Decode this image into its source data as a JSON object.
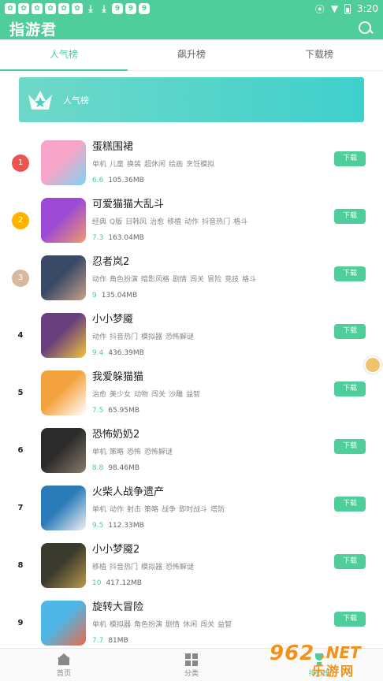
{
  "status_bar": {
    "left_icons": [
      "paw-notif-icon",
      "paw-notif-icon",
      "paw-notif-icon",
      "paw-notif-icon",
      "paw-notif-icon",
      "paw-notif-icon",
      "download-icon",
      "download-icon",
      "g-notif-icon",
      "g-notif-icon",
      "g-notif-icon"
    ],
    "time": "3:20"
  },
  "header": {
    "title": "指游君"
  },
  "tabs": [
    {
      "label": "人气榜",
      "active": true
    },
    {
      "label": "飙升榜",
      "active": false
    },
    {
      "label": "下载榜",
      "active": false
    }
  ],
  "banner": {
    "title": "人气榜"
  },
  "download_label": "下载",
  "items": [
    {
      "rank": "1",
      "name": "蛋糕围裙",
      "tags": [
        "单机",
        "儿童",
        "换装",
        "超休闲",
        "绘画",
        "烹饪模拟"
      ],
      "score": "6.6",
      "size": "105.36MB",
      "rank_color": "#ef5350",
      "icon_colors": [
        "#f6a5c8",
        "#7fd3ef"
      ]
    },
    {
      "rank": "2",
      "name": "可爱猫猫大乱斗",
      "tags": [
        "经典",
        "Q版",
        "日韩风",
        "治愈",
        "移植",
        "动作",
        "抖音热门",
        "格斗"
      ],
      "score": "7.3",
      "size": "163.04MB",
      "rank_color": "#ffb300",
      "icon_colors": [
        "#9c4ad6",
        "#f39a6b"
      ]
    },
    {
      "rank": "3",
      "name": "忍者岚2",
      "tags": [
        "动作",
        "角色扮演",
        "暗影风格",
        "剧情",
        "闯关",
        "冒险",
        "竞技",
        "格斗"
      ],
      "score": "9",
      "size": "135.04MB",
      "rank_color": "#d7b8a0",
      "icon_colors": [
        "#3a4a66",
        "#c9a089"
      ]
    },
    {
      "rank": "4",
      "name": "小小梦魇",
      "tags": [
        "动作",
        "抖音热门",
        "模拟器",
        "恐怖解谜"
      ],
      "score": "9.4",
      "size": "436.39MB",
      "icon_colors": [
        "#6a3f7e",
        "#f2c53a"
      ]
    },
    {
      "rank": "5",
      "name": "我爱躲猫猫",
      "tags": [
        "治愈",
        "美少女",
        "动物",
        "闯关",
        "沙雕",
        "益智"
      ],
      "score": "7.5",
      "size": "65.95MB",
      "icon_colors": [
        "#f3a23d",
        "#ffffff"
      ]
    },
    {
      "rank": "6",
      "name": "恐怖奶奶2",
      "tags": [
        "单机",
        "策略",
        "恐怖",
        "恐怖解谜"
      ],
      "score": "8.8",
      "size": "98.46MB",
      "icon_colors": [
        "#2b2b2b",
        "#8a7a6a"
      ]
    },
    {
      "rank": "7",
      "name": "火柴人战争遗产",
      "tags": [
        "单机",
        "动作",
        "射击",
        "策略",
        "战争",
        "即时战斗",
        "塔防"
      ],
      "score": "9.5",
      "size": "112.33MB",
      "icon_colors": [
        "#2a7ab8",
        "#f2f2f2"
      ]
    },
    {
      "rank": "8",
      "name": "小小梦魇2",
      "tags": [
        "移植",
        "抖音热门",
        "模拟器",
        "恐怖解谜"
      ],
      "score": "10",
      "size": "417.12MB",
      "icon_colors": [
        "#3a3a2e",
        "#b89a4a"
      ]
    },
    {
      "rank": "9",
      "name": "旋转大冒险",
      "tags": [
        "单机",
        "模拟器",
        "角色扮演",
        "剧情",
        "休闲",
        "闯关",
        "益智"
      ],
      "score": "7.7",
      "size": "81MB",
      "icon_colors": [
        "#4fb6e8",
        "#e96b4a"
      ]
    }
  ],
  "bottom_nav": [
    {
      "label": "首页",
      "active": false
    },
    {
      "label": "分类",
      "active": false
    },
    {
      "label": "排行榜",
      "active": true
    }
  ],
  "watermark": {
    "num": "962",
    "net": ".NET",
    "cn": "乐游网"
  },
  "accent_color": "#4fcd9a"
}
